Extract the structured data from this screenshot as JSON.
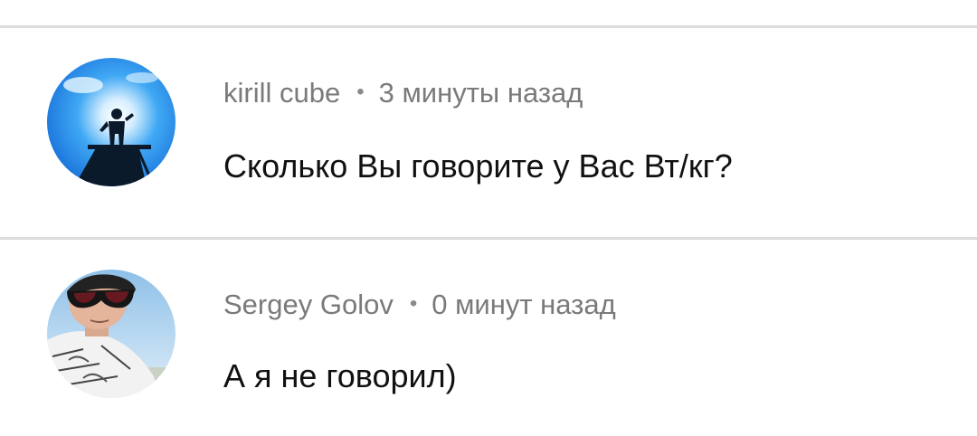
{
  "comments": [
    {
      "author": "kirill cube",
      "separator": "•",
      "time": "3 минуты назад",
      "text": "Сколько Вы говорите у Вас Вт/кг?",
      "avatar_icon": "avatar-silhouette-sky"
    },
    {
      "author": "Sergey Golov",
      "separator": "•",
      "time": "0 минут назад",
      "text": "А я не говорил)",
      "avatar_icon": "avatar-person-sunglasses"
    }
  ],
  "colors": {
    "divider": "#dcdcdc",
    "meta_text": "#7a7a7a",
    "body_text": "#111111"
  }
}
